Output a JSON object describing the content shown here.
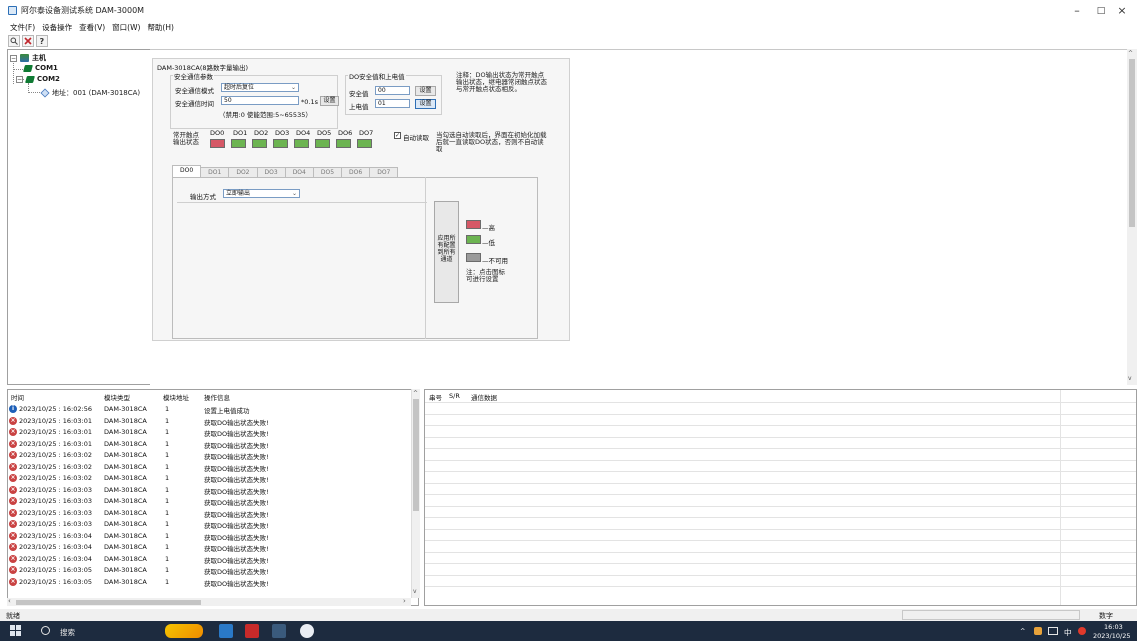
{
  "window": {
    "title": "阿尔泰设备测试系统 DAM-3000M",
    "minimize": "–",
    "maximize": "□",
    "close": "×"
  },
  "menu": [
    "文件(F)",
    "设备操作",
    "查看(V)",
    "窗口(W)",
    "帮助(H)"
  ],
  "tree": {
    "root": "主机",
    "com1": "COM1",
    "com2": "COM2",
    "address": "地址：001 (DAM-3018CA)"
  },
  "device": {
    "panel_title": "DAM-3018CA(8路数字量输出)",
    "comm_group_title": "安全通信参数",
    "mode_label": "安全通信模式",
    "mode_value": "超时后复位",
    "time_label": "安全通信时间",
    "time_value": "50",
    "time_unit": "*0.1s",
    "time_set_button": "设置",
    "time_hint": "（禁用:0 使能范围:5~65535）",
    "do_group_title": "DO安全值和上电值",
    "safe_label": "安全值",
    "safe_value": "00",
    "safe_set_button": "设置",
    "power_label": "上电值",
    "power_value": "01",
    "power_set_button": "设置",
    "note": "注释：DO输出状态为常开触点输出状态，继电器常闭触点状态与常开触点状态相反。",
    "contact_label": "常开触点输出状态",
    "channels": [
      "DO0",
      "DO1",
      "DO2",
      "DO3",
      "DO4",
      "DO5",
      "DO6",
      "DO7"
    ],
    "channel_states": [
      "high",
      "low",
      "low",
      "low",
      "low",
      "low",
      "low",
      "low"
    ],
    "auto_read_label": "自动读取",
    "auto_read_checked": "✓",
    "auto_read_note": "当勾选自动读取后，界面在初始化加载后就一直读取DO状态，否则不自动读取",
    "tabs": [
      "DO0",
      "DO1",
      "DO2",
      "DO3",
      "DO4",
      "DO5",
      "DO6",
      "DO7"
    ],
    "output_mode_label": "输出方式",
    "output_mode_value": "立即输出",
    "apply_button": "应用所有配置到所有通道",
    "legend_high": "—高",
    "legend_low": "—低",
    "legend_na": "—不可用",
    "legend_note": "注：点击图标可进行设置"
  },
  "log": {
    "headers": [
      "时间",
      "模块类型",
      "模块地址",
      "操作信息"
    ],
    "rows": [
      {
        "level": "info",
        "time": "2023/10/25 : 16:02:56",
        "type": "DAM-3018CA",
        "addr": "1",
        "msg": "设置上电值成功"
      },
      {
        "level": "error",
        "time": "2023/10/25 : 16:03:01",
        "type": "DAM-3018CA",
        "addr": "1",
        "msg": "获取DO输出状态失败!"
      },
      {
        "level": "error",
        "time": "2023/10/25 : 16:03:01",
        "type": "DAM-3018CA",
        "addr": "1",
        "msg": "获取DO输出状态失败!"
      },
      {
        "level": "error",
        "time": "2023/10/25 : 16:03:01",
        "type": "DAM-3018CA",
        "addr": "1",
        "msg": "获取DO输出状态失败!"
      },
      {
        "level": "error",
        "time": "2023/10/25 : 16:03:02",
        "type": "DAM-3018CA",
        "addr": "1",
        "msg": "获取DO输出状态失败!"
      },
      {
        "level": "error",
        "time": "2023/10/25 : 16:03:02",
        "type": "DAM-3018CA",
        "addr": "1",
        "msg": "获取DO输出状态失败!"
      },
      {
        "level": "error",
        "time": "2023/10/25 : 16:03:02",
        "type": "DAM-3018CA",
        "addr": "1",
        "msg": "获取DO输出状态失败!"
      },
      {
        "level": "error",
        "time": "2023/10/25 : 16:03:03",
        "type": "DAM-3018CA",
        "addr": "1",
        "msg": "获取DO输出状态失败!"
      },
      {
        "level": "error",
        "time": "2023/10/25 : 16:03:03",
        "type": "DAM-3018CA",
        "addr": "1",
        "msg": "获取DO输出状态失败!"
      },
      {
        "level": "error",
        "time": "2023/10/25 : 16:03:03",
        "type": "DAM-3018CA",
        "addr": "1",
        "msg": "获取DO输出状态失败!"
      },
      {
        "level": "error",
        "time": "2023/10/25 : 16:03:03",
        "type": "DAM-3018CA",
        "addr": "1",
        "msg": "获取DO输出状态失败!"
      },
      {
        "level": "error",
        "time": "2023/10/25 : 16:03:04",
        "type": "DAM-3018CA",
        "addr": "1",
        "msg": "获取DO输出状态失败!"
      },
      {
        "level": "error",
        "time": "2023/10/25 : 16:03:04",
        "type": "DAM-3018CA",
        "addr": "1",
        "msg": "获取DO输出状态失败!"
      },
      {
        "level": "error",
        "time": "2023/10/25 : 16:03:04",
        "type": "DAM-3018CA",
        "addr": "1",
        "msg": "获取DO输出状态失败!"
      },
      {
        "level": "error",
        "time": "2023/10/25 : 16:03:05",
        "type": "DAM-3018CA",
        "addr": "1",
        "msg": "获取DO输出状态失败!"
      },
      {
        "level": "error",
        "time": "2023/10/25 : 16:03:05",
        "type": "DAM-3018CA",
        "addr": "1",
        "msg": "获取DO输出状态失败!"
      }
    ]
  },
  "comm": {
    "headers": [
      "串号",
      "S/R",
      "通信数据"
    ]
  },
  "status": {
    "left": "就绪",
    "right": "数字"
  },
  "taskbar": {
    "search": "搜索",
    "tray_caret": "^",
    "ime": "中",
    "time": "16:03",
    "date": "2023/10/25"
  },
  "colors": {
    "led_high": "#d55866",
    "led_low": "#6cb451",
    "led_na": "#9a9a9a",
    "taskbar": "#1d2b3f"
  }
}
